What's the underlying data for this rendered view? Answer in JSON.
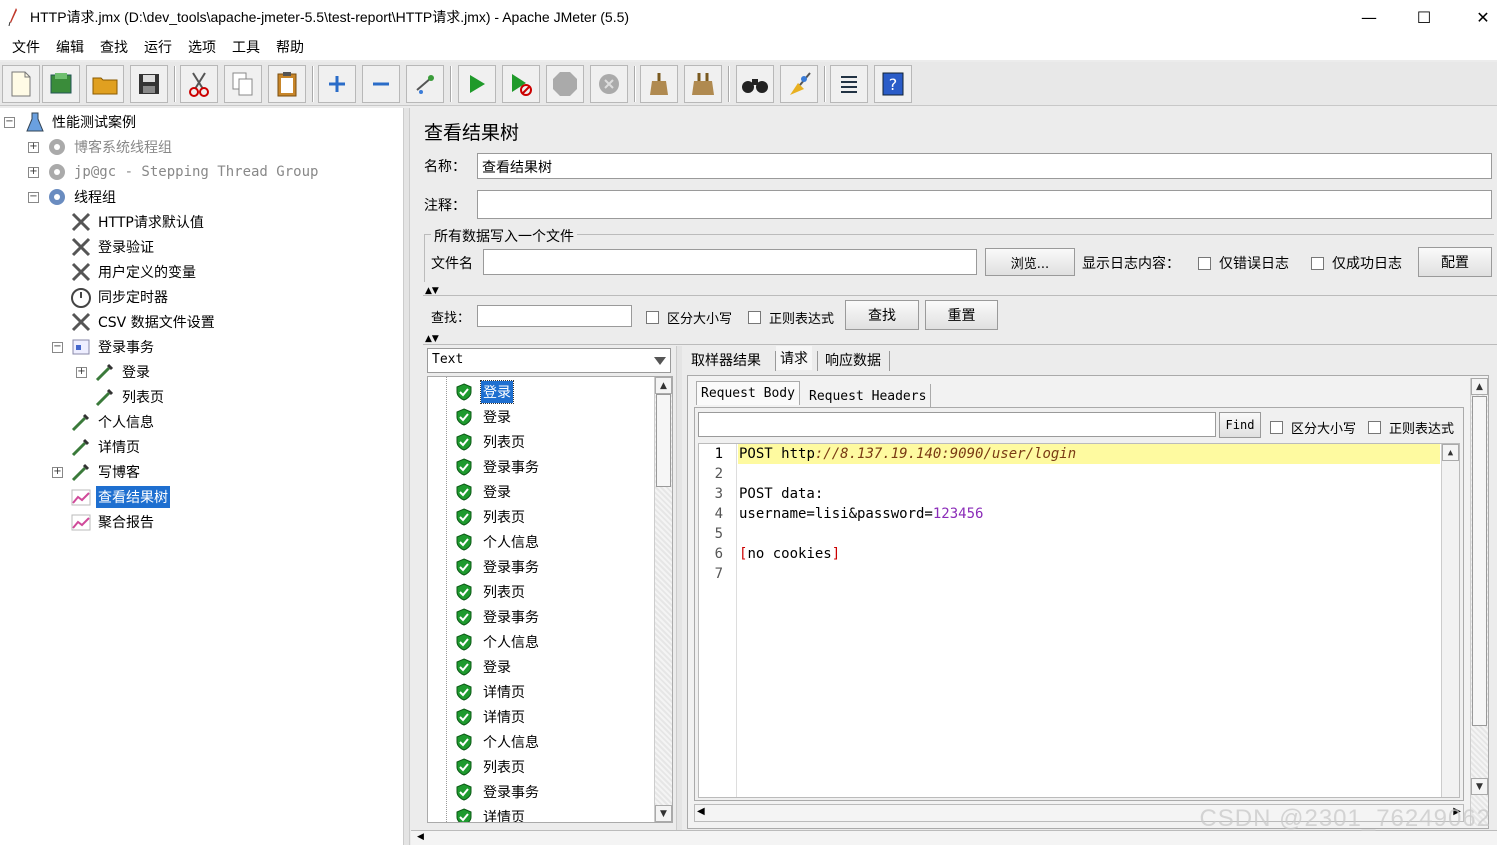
{
  "window": {
    "title": "HTTP请求.jmx (D:\\dev_tools\\apache-jmeter-5.5\\test-report\\HTTP请求.jmx) - Apache JMeter (5.5)",
    "minimize": "—",
    "maximize": "☐",
    "close": "✕"
  },
  "menu": [
    "文件",
    "编辑",
    "查找",
    "运行",
    "选项",
    "工具",
    "帮助"
  ],
  "toolbar": [
    "new",
    "templates",
    "open",
    "save",
    "cut",
    "copy",
    "paste",
    "expand",
    "collapse",
    "toggle",
    "start",
    "start-no-pause",
    "stop",
    "shutdown",
    "clear",
    "clear-all",
    "search",
    "reset-search",
    "function-helper",
    "help"
  ],
  "tree": {
    "root": "性能测试案例",
    "items": [
      {
        "label": "博客系统线程组",
        "disabled": true
      },
      {
        "label": "jp@gc - Stepping Thread Group",
        "disabled": true
      },
      {
        "label": "线程组",
        "disabled": false
      },
      {
        "label": "HTTP请求默认值"
      },
      {
        "label": "登录验证"
      },
      {
        "label": "用户定义的变量"
      },
      {
        "label": "同步定时器"
      },
      {
        "label": "CSV 数据文件设置"
      },
      {
        "label": "登录事务"
      },
      {
        "label": "登录"
      },
      {
        "label": "列表页"
      },
      {
        "label": "个人信息"
      },
      {
        "label": "详情页"
      },
      {
        "label": "写博客"
      },
      {
        "label": "查看结果树"
      },
      {
        "label": "聚合报告"
      }
    ]
  },
  "panel": {
    "title": "查看结果树",
    "name_label": "名称：",
    "name_value": "查看结果树",
    "comment_label": "注释：",
    "comment_value": "",
    "file_group_title": "所有数据写入一个文件",
    "filename_label": "文件名",
    "filename_value": "",
    "browse_button": "浏览...",
    "log_label": "显示日志内容：",
    "errors_only": "仅错误日志",
    "success_only": "仅成功日志",
    "config_button": "配置",
    "search_label": "查找：",
    "search_value": "",
    "case_sensitive": "区分大小写",
    "regex": "正则表达式",
    "search_button": "查找",
    "reset_button": "重置",
    "renderer": "Text"
  },
  "results": [
    "登录",
    "登录",
    "列表页",
    "登录事务",
    "登录",
    "列表页",
    "个人信息",
    "登录事务",
    "列表页",
    "登录事务",
    "个人信息",
    "登录",
    "详情页",
    "详情页",
    "个人信息",
    "列表页",
    "登录事务",
    "详情页"
  ],
  "tabs": {
    "main": [
      "取样器结果",
      "请求",
      "响应数据"
    ],
    "sub": [
      "Request Body",
      "Request Headers"
    ]
  },
  "request_search": {
    "value": "",
    "find_button": "Find",
    "case_sensitive": "区分大小写",
    "regex": "正则表达式"
  },
  "code": {
    "line_numbers": [
      "1",
      "2",
      "3",
      "4",
      "5",
      "6",
      "7"
    ],
    "l1_method": "POST ",
    "l1_scheme": "http",
    "l1_rest": "://8.137.19.140:9090/user/login",
    "l3": "POST data:",
    "l4_a": "username=lisi&password=",
    "l4_b": "123456",
    "l6_open": "[",
    "l6_text": "no cookies",
    "l6_close": "]"
  },
  "watermark": "CSDN @2301_76249062"
}
